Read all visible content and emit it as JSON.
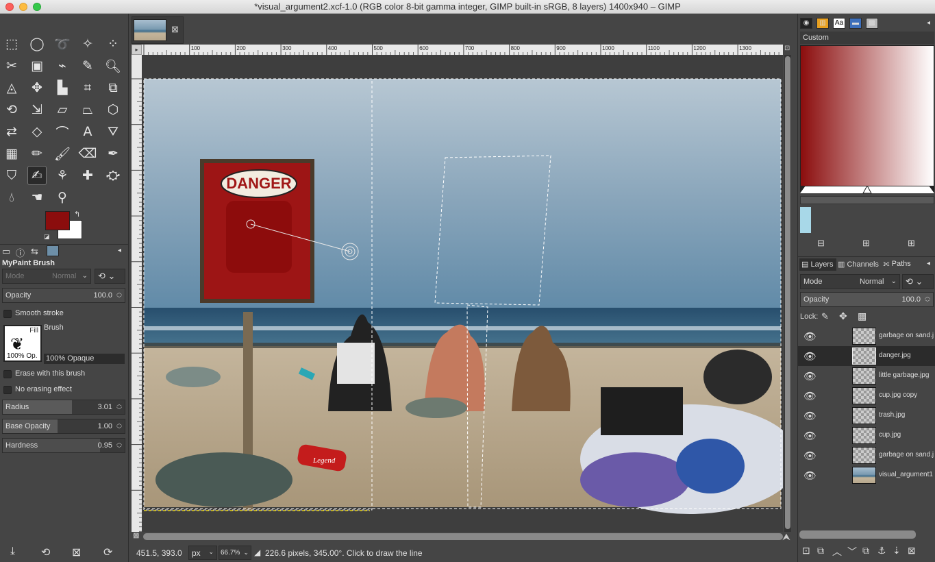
{
  "window": {
    "title": "*visual_argument2.xcf-1.0 (RGB color 8-bit gamma integer, GIMP built-in sRGB, 8 layers) 1400x940 – GIMP"
  },
  "toolbox": {
    "tools": [
      {
        "name": "rect-select-icon",
        "glyph": "⬚"
      },
      {
        "name": "ellipse-select-icon",
        "glyph": "◯"
      },
      {
        "name": "free-select-icon",
        "glyph": "➰"
      },
      {
        "name": "fuzzy-select-icon",
        "glyph": "✧"
      },
      {
        "name": "by-color-select-icon",
        "glyph": "⁘"
      },
      {
        "name": "scissors-icon",
        "glyph": "✂"
      },
      {
        "name": "foreground-select-icon",
        "glyph": "▣"
      },
      {
        "name": "paths-icon",
        "glyph": "⌁"
      },
      {
        "name": "color-picker-icon",
        "glyph": "✎"
      },
      {
        "name": "zoom-icon",
        "glyph": "🔍︎"
      },
      {
        "name": "measure-icon",
        "glyph": "◬"
      },
      {
        "name": "move-icon",
        "glyph": "✥"
      },
      {
        "name": "align-icon",
        "glyph": "▙"
      },
      {
        "name": "crop-icon",
        "glyph": "⌗"
      },
      {
        "name": "unified-transform-icon",
        "glyph": "⧉"
      },
      {
        "name": "rotate-icon",
        "glyph": "⟲"
      },
      {
        "name": "scale-icon",
        "glyph": "⇲"
      },
      {
        "name": "shear-icon",
        "glyph": "▱"
      },
      {
        "name": "perspective-icon",
        "glyph": "⏢"
      },
      {
        "name": "3d-transform-icon",
        "glyph": "⬡"
      },
      {
        "name": "warp-transform-icon",
        "glyph": "⇄"
      },
      {
        "name": "handle-transform-icon",
        "glyph": "◇"
      },
      {
        "name": "cage-transform-icon",
        "glyph": "⌒"
      },
      {
        "name": "text-icon",
        "glyph": "A"
      },
      {
        "name": "bucket-fill-icon",
        "glyph": "⛛"
      },
      {
        "name": "gradient-icon",
        "glyph": "▦"
      },
      {
        "name": "pencil-icon",
        "glyph": "✏"
      },
      {
        "name": "paintbrush-icon",
        "glyph": "🖌︎"
      },
      {
        "name": "eraser-icon",
        "glyph": "⌫"
      },
      {
        "name": "airbrush-icon",
        "glyph": "✒"
      },
      {
        "name": "ink-icon",
        "glyph": "⛉"
      },
      {
        "name": "mypaint-brush-icon",
        "glyph": "✍"
      },
      {
        "name": "clone-icon",
        "glyph": "⚘"
      },
      {
        "name": "heal-icon",
        "glyph": "✚"
      },
      {
        "name": "perspective-clone-icon",
        "glyph": "⛮"
      },
      {
        "name": "blur-sharpen-icon",
        "glyph": "💧︎"
      },
      {
        "name": "smudge-icon",
        "glyph": "☚"
      },
      {
        "name": "dodge-burn-icon",
        "glyph": "⚲"
      }
    ],
    "foreground_color": "#8b0d0d",
    "background_color": "#ffffff"
  },
  "tool_options": {
    "title": "MyPaint Brush",
    "mode_label": "Mode",
    "mode_value": "Normal",
    "opacity_label": "Opacity",
    "opacity_value": "100.0",
    "smooth_stroke": "Smooth stroke",
    "brush_label": "Brush",
    "brush_preview_top": "Fill",
    "brush_preview_bottom": "100% Op.",
    "brush_name": "100% Opaque",
    "erase_with_brush": "Erase with this brush",
    "no_erasing": "No erasing effect",
    "radius_label": "Radius",
    "radius_value": "3.01",
    "base_opacity_label": "Base Opacity",
    "base_opacity_value": "1.00",
    "hardness_label": "Hardness",
    "hardness_value": "0.95"
  },
  "canvas": {
    "ruler_ticks": [
      "100",
      "200",
      "300",
      "400",
      "500",
      "600",
      "700",
      "800",
      "900",
      "1000",
      "1100",
      "1200",
      "1300"
    ],
    "sign_text": "DANGER",
    "can_text": "Legend"
  },
  "statusbar": {
    "coords": "451.5, 393.0",
    "unit": "px",
    "zoom": "66.7%",
    "message": "226.6 pixels, 345.00°. Click to draw the line"
  },
  "gradients": {
    "title": "Custom",
    "start_color": "#8b0d0d",
    "end_color": "#ffffff",
    "swatch_color": "#a8d8e8"
  },
  "layers_panel": {
    "tabs": [
      "Layers",
      "Channels",
      "Paths"
    ],
    "mode_label": "Mode",
    "mode_value": "Normal",
    "opacity_label": "Opacity",
    "opacity_value": "100.0",
    "lock_label": "Lock:",
    "layers": [
      {
        "name": "garbage on sand.j",
        "selected": false
      },
      {
        "name": "danger.jpg",
        "selected": true
      },
      {
        "name": "little garbage.jpg",
        "selected": false
      },
      {
        "name": "cup.jpg copy",
        "selected": false
      },
      {
        "name": "trash.jpg",
        "selected": false
      },
      {
        "name": "cup.jpg",
        "selected": false
      },
      {
        "name": "garbage on sand.j",
        "selected": false
      },
      {
        "name": "visual_argument1",
        "selected": false
      }
    ]
  }
}
